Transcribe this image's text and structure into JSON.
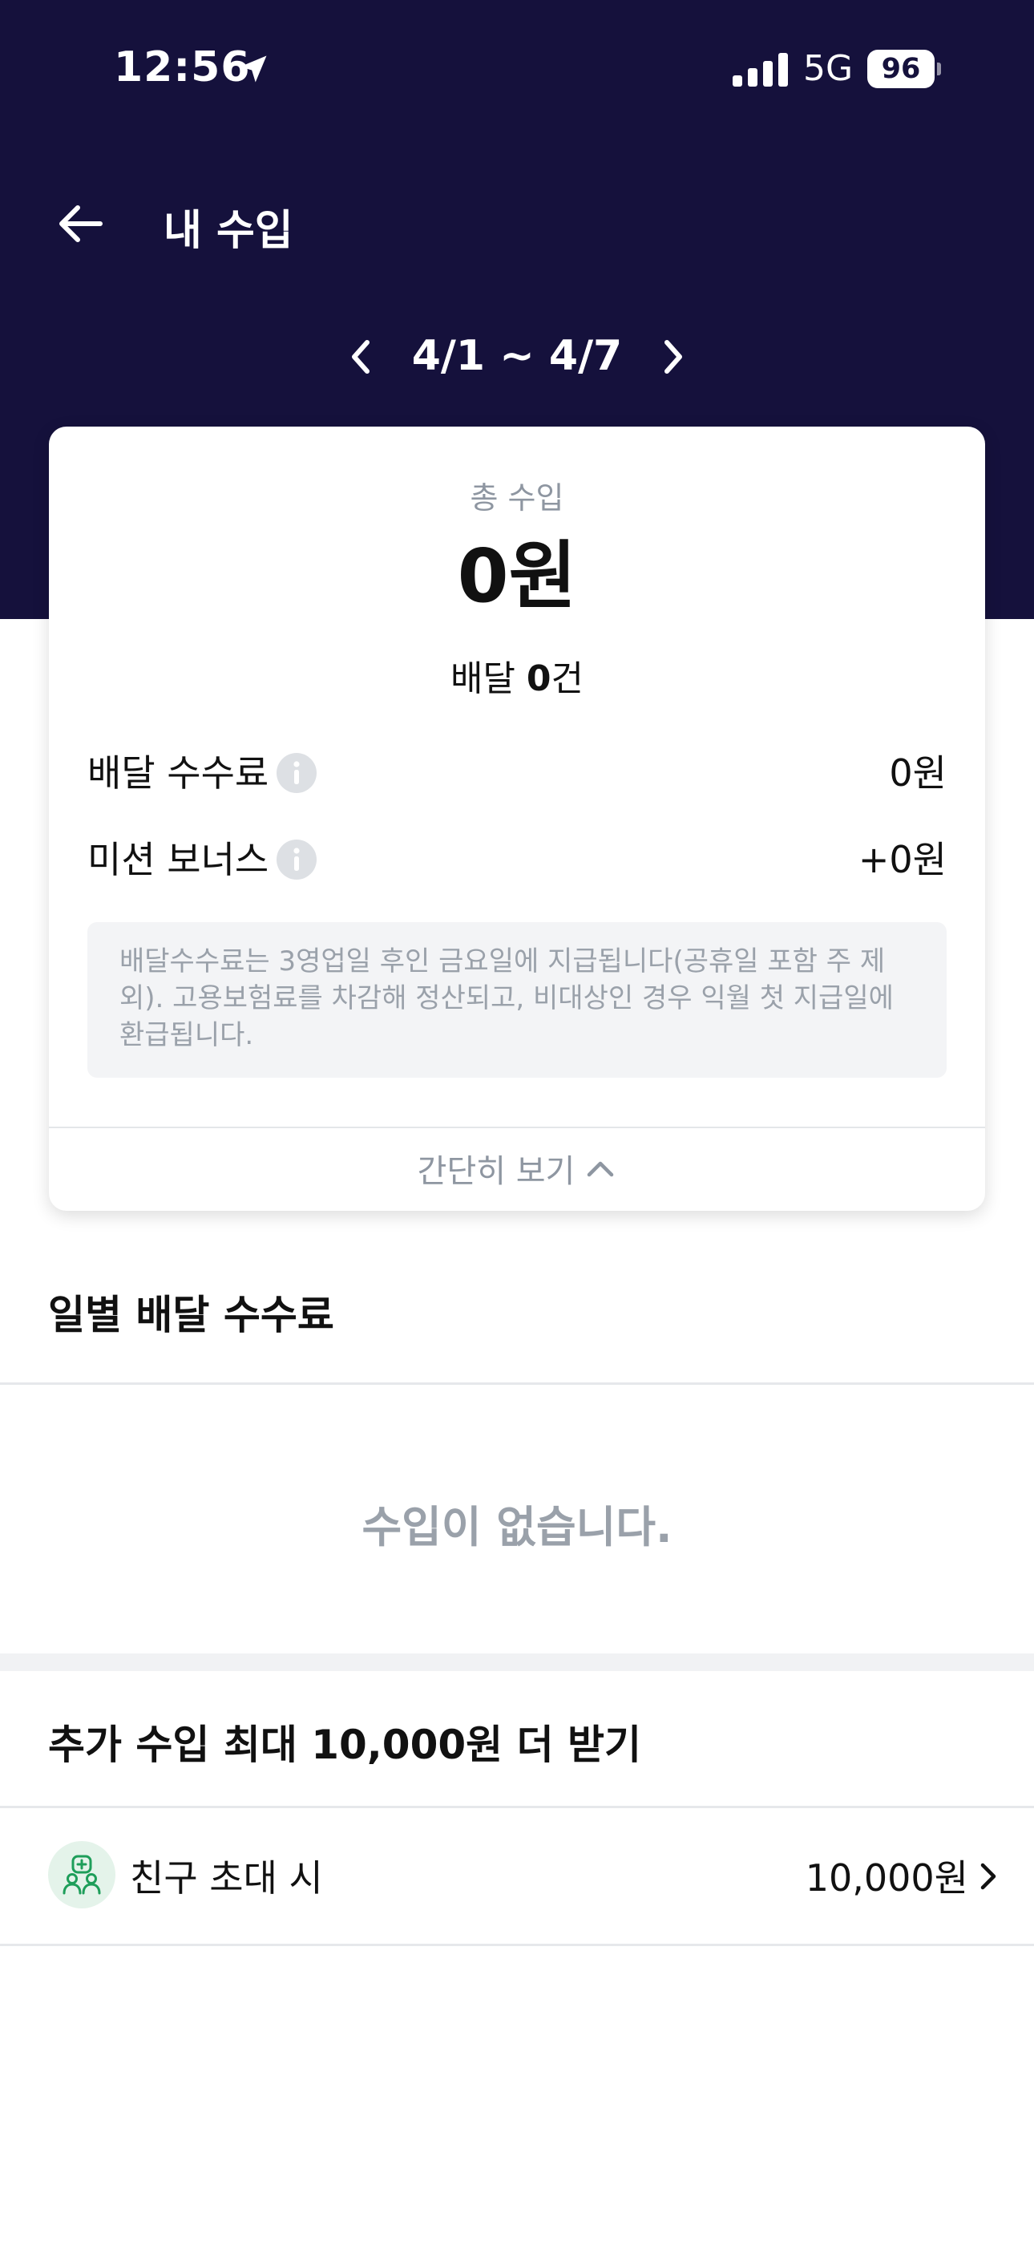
{
  "status_bar": {
    "time": "12:56",
    "network": "5G",
    "battery": "96"
  },
  "header": {
    "title": "내 수입"
  },
  "week_nav": {
    "range": "4/1 ~ 4/7"
  },
  "summary": {
    "total_label": "총 수입",
    "total_amount": "0원",
    "delivery_prefix": "배달 ",
    "delivery_count": "0",
    "delivery_suffix": "건",
    "rows": [
      {
        "label": "배달 수수료",
        "value": "0원"
      },
      {
        "label": "미션 보너스",
        "value": "+0원"
      }
    ],
    "notice": "배달수수료는 3영업일 후인 금요일에 지급됩니다(공휴일 포함 주 제외). 고용보험료를 차감해 정산되고, 비대상인 경우 익월 첫 지급일에 환급됩니다.",
    "collapse_label": "간단히 보기"
  },
  "daily": {
    "title": "일별 배달 수수료",
    "empty_message": "수입이 없습니다."
  },
  "bonus": {
    "title": "추가 수입 최대 10,000원 더 받기",
    "items": [
      {
        "label": "친구 초대 시",
        "amount": "10,000원",
        "icon": "friends-invite-icon"
      }
    ]
  },
  "colors": {
    "header_bg": "#15113c",
    "muted_text": "#8e96a1",
    "accent_green": "#1e9e5a"
  }
}
